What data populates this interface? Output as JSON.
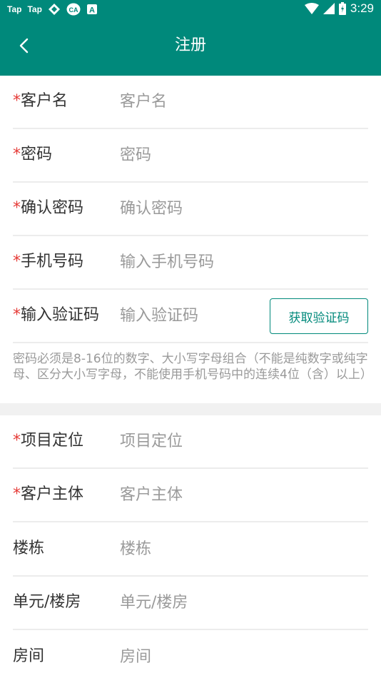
{
  "status_bar": {
    "apps": [
      "Tap",
      "Tap"
    ],
    "time": "3:29",
    "icons": [
      "app-logo-icon",
      "ca-logo-icon",
      "a-logo-icon",
      "wifi-icon",
      "cellular-signal-icon",
      "battery-icon"
    ]
  },
  "header": {
    "title": "注册",
    "back_icon": "chevron-left-icon",
    "bg_color": "#00897b"
  },
  "form1": {
    "customer_name": {
      "label": "客户名",
      "required": "*",
      "placeholder": "客户名"
    },
    "password": {
      "label": "密码",
      "required": "*",
      "placeholder": "密码"
    },
    "confirm_password": {
      "label": "确认密码",
      "required": "*",
      "placeholder": "确认密码"
    },
    "phone": {
      "label": "手机号码",
      "required": "*",
      "placeholder": "输入手机号码"
    },
    "code": {
      "label": "输入验证码",
      "required": "*",
      "placeholder": "输入验证码",
      "button": "获取验证码"
    }
  },
  "hint": "密码必须是8-16位的数字、大小写字母组合（不能是纯数字或纯字母、区分大小写字母，不能使用手机号码中的连续4位（含）以上）",
  "form2": {
    "project_location": {
      "label": "项目定位",
      "required": "*",
      "placeholder": "项目定位"
    },
    "customer_entity": {
      "label": "客户主体",
      "required": "*",
      "placeholder": "客户主体"
    },
    "building": {
      "label": "楼栋",
      "placeholder": "楼栋"
    },
    "unit": {
      "label": "单元/楼房",
      "placeholder": "单元/楼房"
    },
    "room": {
      "label": "房间",
      "placeholder": "房间"
    }
  }
}
